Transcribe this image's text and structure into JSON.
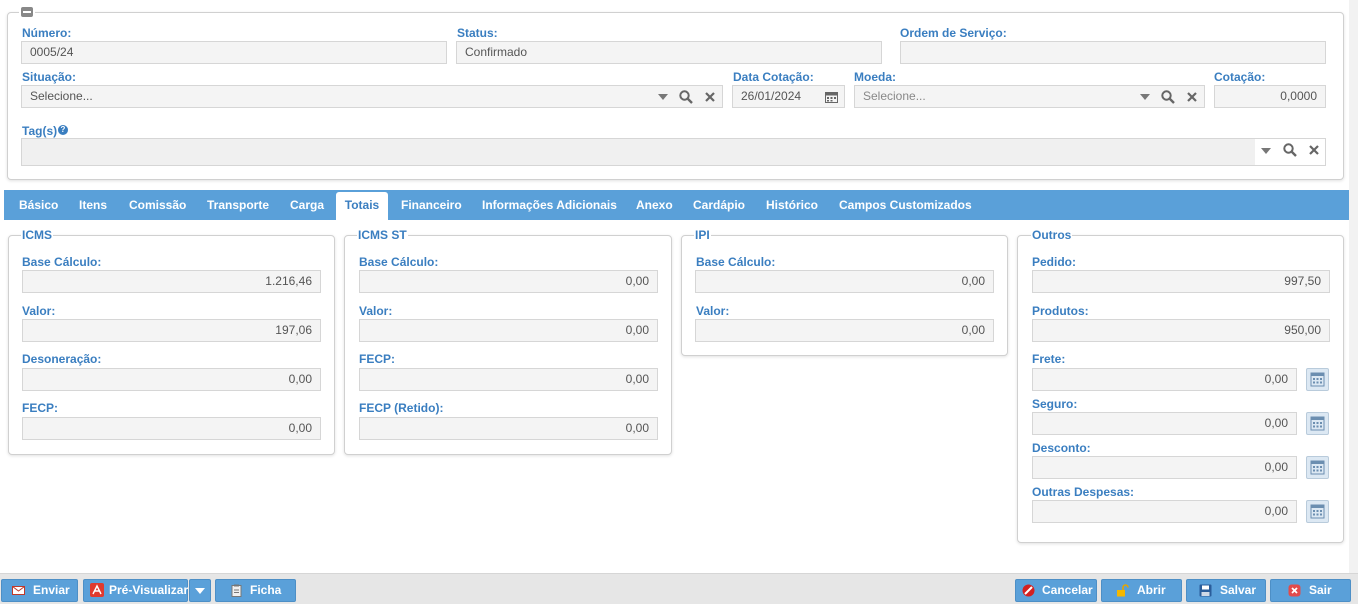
{
  "header": {
    "numero": {
      "label": "Número:",
      "value": "0005/24"
    },
    "status": {
      "label": "Status:",
      "value": "Confirmado"
    },
    "ordem_servico": {
      "label": "Ordem de Serviço:",
      "value": ""
    },
    "situacao": {
      "label": "Situação:",
      "value": "Selecione..."
    },
    "data_cotacao": {
      "label": "Data Cotação:",
      "value": "26/01/2024"
    },
    "moeda": {
      "label": "Moeda:",
      "value": "Selecione..."
    },
    "cotacao": {
      "label": "Cotação:",
      "value": "0,0000"
    },
    "tags": {
      "label": "Tag(s)",
      "value": ""
    }
  },
  "tabs": [
    {
      "label": "Básico"
    },
    {
      "label": "Itens"
    },
    {
      "label": "Comissão"
    },
    {
      "label": "Transporte"
    },
    {
      "label": "Carga"
    },
    {
      "label": "Totais"
    },
    {
      "label": "Financeiro"
    },
    {
      "label": "Informações Adicionais"
    },
    {
      "label": "Anexo"
    },
    {
      "label": "Cardápio"
    },
    {
      "label": "Histórico"
    },
    {
      "label": "Campos Customizados"
    }
  ],
  "active_tab": "Totais",
  "icms": {
    "title": "ICMS",
    "base_calculo": {
      "label": "Base Cálculo:",
      "value": "1.216,46"
    },
    "valor": {
      "label": "Valor:",
      "value": "197,06"
    },
    "desoneracao": {
      "label": "Desoneração:",
      "value": "0,00"
    },
    "fecp": {
      "label": "FECP:",
      "value": "0,00"
    }
  },
  "icms_st": {
    "title": "ICMS ST",
    "base_calculo": {
      "label": "Base Cálculo:",
      "value": "0,00"
    },
    "valor": {
      "label": "Valor:",
      "value": "0,00"
    },
    "fecp": {
      "label": "FECP:",
      "value": "0,00"
    },
    "fecp_retido": {
      "label": "FECP (Retido):",
      "value": "0,00"
    }
  },
  "ipi": {
    "title": "IPI",
    "base_calculo": {
      "label": "Base Cálculo:",
      "value": "0,00"
    },
    "valor": {
      "label": "Valor:",
      "value": "0,00"
    }
  },
  "outros": {
    "title": "Outros",
    "pedido": {
      "label": "Pedido:",
      "value": "997,50"
    },
    "produtos": {
      "label": "Produtos:",
      "value": "950,00"
    },
    "frete": {
      "label": "Frete:",
      "value": "0,00"
    },
    "seguro": {
      "label": "Seguro:",
      "value": "0,00"
    },
    "desconto": {
      "label": "Desconto:",
      "value": "0,00"
    },
    "outras_despesas": {
      "label": "Outras Despesas:",
      "value": "0,00"
    }
  },
  "footer": {
    "enviar": "Enviar",
    "pre_visualizar": "Pré-Visualizar",
    "ficha": "Ficha",
    "cancelar": "Cancelar",
    "abrir": "Abrir",
    "salvar": "Salvar",
    "sair": "Sair"
  },
  "colors": {
    "accent": "#5aa0d9",
    "label": "#3a7ec0",
    "pdf_red": "#e03a2f"
  }
}
